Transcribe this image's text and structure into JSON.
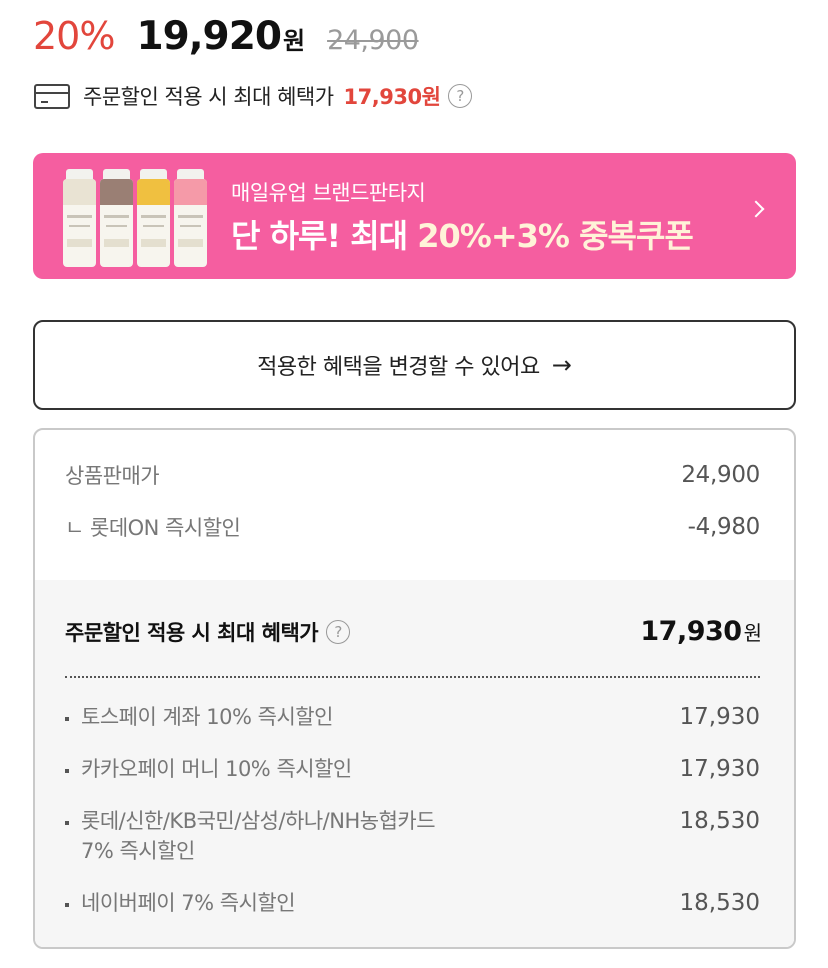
{
  "price": {
    "discount_rate": "20%",
    "sale_price": "19,920",
    "sale_unit": "원",
    "original_price": "24,900"
  },
  "benefit": {
    "label": "주문할인 적용 시 최대 혜택가",
    "value": "17,930원"
  },
  "banner": {
    "subtitle": "매일유업 브랜드판타지",
    "title_prefix": "단 하루! 최대 ",
    "title_highlight": "20%+3% 중복쿠폰",
    "bg_color": "#f55ea0"
  },
  "change_button": {
    "label": "적용한 혜택을 변경할 수 있어요"
  },
  "details": {
    "rows": [
      {
        "label": "상품판매가",
        "value": "24,900"
      },
      {
        "label": "ㄴ 롯데ON 즉시할인",
        "value": "-4,980"
      }
    ],
    "max_label": "주문할인 적용 시 최대 혜택가",
    "max_value": "17,930",
    "max_unit": "원",
    "discounts": [
      {
        "label": "토스페이 계좌 10% 즉시할인",
        "value": "17,930"
      },
      {
        "label": "카카오페이 머니 10% 즉시할인",
        "value": "17,930"
      },
      {
        "label_line1": "롯데/신한/KB국민/삼성/하나/NH농협카드",
        "label_line2": "7% 즉시할인",
        "value": "18,530"
      },
      {
        "label": "네이버페이 7% 즉시할인",
        "value": "18,530"
      }
    ]
  },
  "colors": {
    "accent_red": "#e2463c"
  }
}
